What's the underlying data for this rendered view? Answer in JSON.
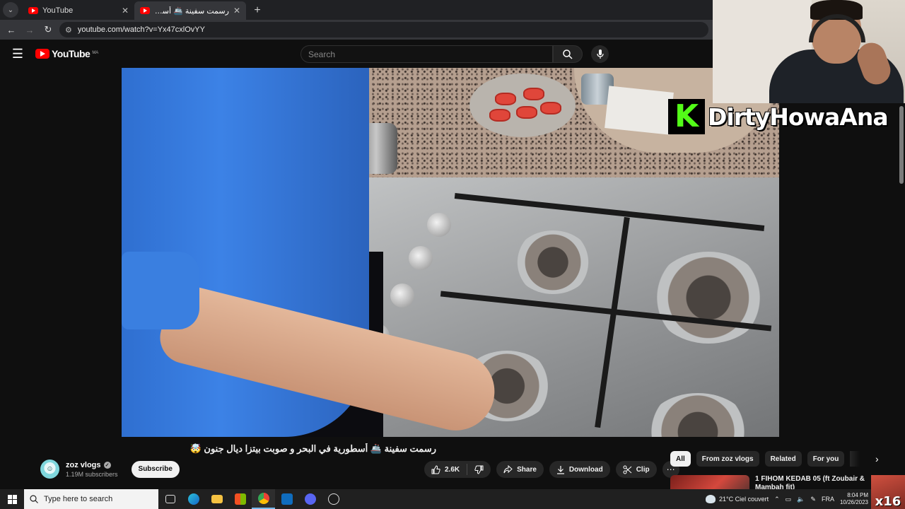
{
  "browser": {
    "tabs": [
      {
        "title": "YouTube",
        "active": false
      },
      {
        "title": "رسمت سفينة 🚢 أسطورية في ال...",
        "active": true
      }
    ],
    "url": "youtube.com/watch?v=Yx47cxlOvYY"
  },
  "header": {
    "logo_text": "YouTube",
    "logo_country": "MA",
    "search_placeholder": "Search"
  },
  "overlay": {
    "kick_letter": "K",
    "streamer_name": "DirtyHowaAna",
    "corner_badge": "x16"
  },
  "video": {
    "title": "رسمت سفينة 🚢 أسطورية في البحر و صوبت بيتزا ديال جنون 🤯"
  },
  "channel": {
    "name": "zoz vlogs",
    "subscribers": "1.19M subscribers",
    "subscribe_label": "Subscribe"
  },
  "actions": {
    "likes": "2.6K",
    "share": "Share",
    "download": "Download",
    "clip": "Clip"
  },
  "sidebar": {
    "chips": [
      "All",
      "From zoz vlogs",
      "Related",
      "For you"
    ],
    "active_chip": "All",
    "recommendation": {
      "title": "1 FIHOM KEDAB 05 (ft Zoubair & Mambah fit)"
    }
  },
  "taskbar": {
    "search_placeholder": "Type here to search",
    "weather": "21°C  Ciel couvert",
    "language": "FRA",
    "time": "8:04 PM",
    "date": "10/26/2023"
  },
  "colors": {
    "background": "#0f0f0f",
    "brand_red": "#ff0000",
    "kick_green": "#53fc18"
  }
}
